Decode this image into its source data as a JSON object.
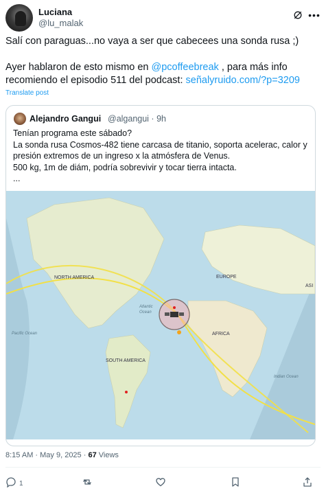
{
  "author": {
    "display_name": "Luciana",
    "handle": "@lu_malak"
  },
  "header_icons": [
    "grok-icon",
    "more-icon"
  ],
  "post": {
    "line1": "Salí con paraguas...no vaya a ser que cabecees una sonda rusa ;)",
    "line2_pre": "Ayer hablaron de esto mismo en ",
    "line2_link": "@pcoffeebreak",
    "line2_post": " , para más info",
    "line3_pre": "recomiendo el episodio 511 del podcast: ",
    "line3_link": "señalyruido.com/?p=3209",
    "translate": "Translate post",
    "link_color": "#1d9bf0"
  },
  "quote": {
    "display_name": "Alejandro Gangui",
    "meta": "@algangui · 9h",
    "lines": [
      "Tenían programa este sábado?",
      "La sonda rusa Cosmos-482 tiene carcasa de titanio, soporta acelerac, calor y",
      "presión extremos de un ingreso x la atmósfera de Venus.",
      "500 kg, 1m de diám, podría sobrevivir y tocar tierra intacta.",
      "..."
    ],
    "map_labels": {
      "north_america": "NORTH AMERICA",
      "europe": "EUROPE",
      "asia": "ASI",
      "atlantic_1": "Atlantic",
      "atlantic_2": "Ocean",
      "pacific": "Pacific Ocean",
      "africa": "AFRICA",
      "south_america": "SOUTH AMERICA",
      "indian": "Indian Ocean"
    }
  },
  "footer": {
    "time": "8:15 AM · May 9, 2025 · ",
    "views_count": "67",
    "views_label": " Views"
  },
  "actions": {
    "reply_count": "1",
    "icons": [
      "reply-icon",
      "repost-icon",
      "like-icon",
      "bookmark-icon",
      "share-icon"
    ]
  }
}
